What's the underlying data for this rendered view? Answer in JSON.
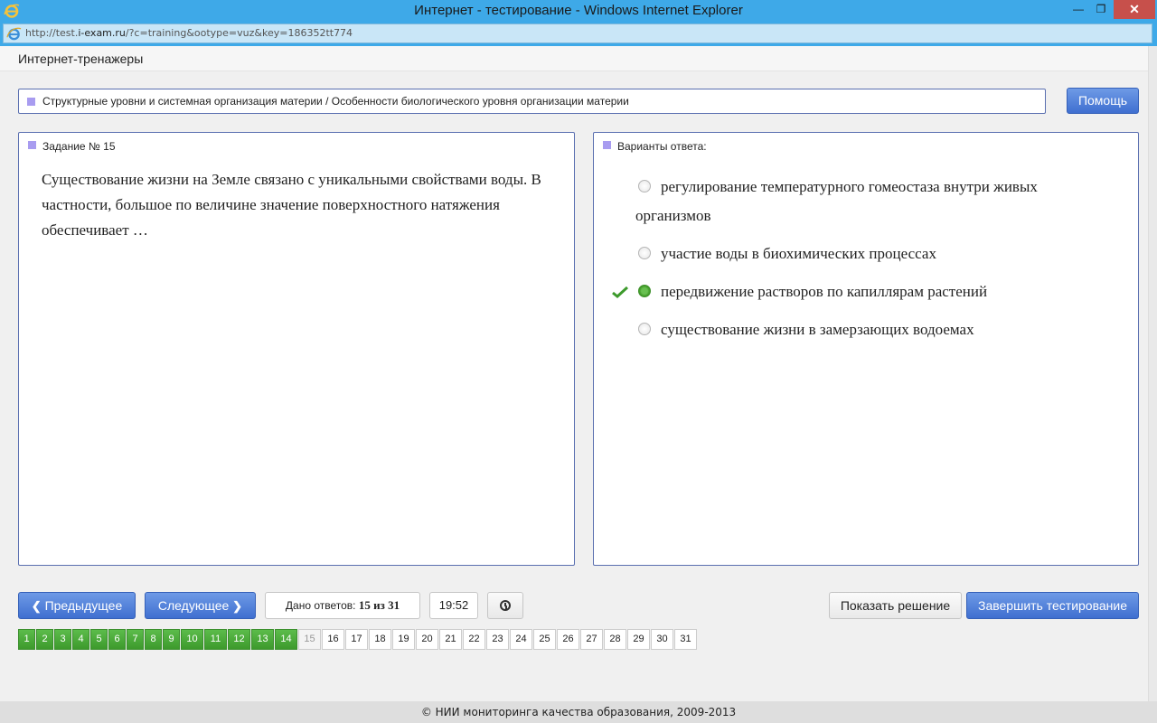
{
  "window": {
    "title": "Интернет - тестирование - Windows Internet Explorer",
    "url_prefix": "http://test.",
    "url_host": "i-exam.ru",
    "url_rest": "/?c=training&ootype=vuz&key=186352tt774",
    "min_glyph": "—",
    "max_glyph": "❐",
    "close_glyph": "✕"
  },
  "header": {
    "brand": "Интернет-тренажеры"
  },
  "breadcrumb": "Структурные уровни и системная организация материи / Особенности биологического уровня организации материи",
  "help_label": "Помощь",
  "question": {
    "heading": "Задание № 15",
    "text": "Существование жизни на Земле связано с уникальными свойствами воды. В частности, большое по величине значение поверхностного натяжения обеспечивает …"
  },
  "answers": {
    "heading": "Варианты ответа:",
    "options": [
      {
        "label": "регулирование температурного гомеостаза внутри живых организмов",
        "selected": false
      },
      {
        "label": "участие воды в биохимических процессах",
        "selected": false
      },
      {
        "label": "передвижение растворов по капиллярам растений",
        "selected": true
      },
      {
        "label": "существование жизни в замерзающих водоемах",
        "selected": false
      }
    ]
  },
  "controls": {
    "prev_label": "Предыдущее",
    "next_label": "Следующее",
    "given_label": "Дано ответов:",
    "given_value": "15 из 31",
    "timer": "19:52",
    "show_solution_label": "Показать решение",
    "finish_label": "Завершить тестирование"
  },
  "pager": {
    "current": 15,
    "pages": [
      "1",
      "2",
      "3",
      "4",
      "5",
      "6",
      "7",
      "8",
      "9",
      "10",
      "11",
      "12",
      "13",
      "14",
      "15",
      "16",
      "17",
      "18",
      "19",
      "20",
      "21",
      "22",
      "23",
      "24",
      "25",
      "26",
      "27",
      "28",
      "29",
      "30",
      "31"
    ],
    "answered_count": 14
  },
  "footer": "© НИИ мониторинга качества образования, 2009-2013",
  "colors": {
    "accent_blue": "#3f6fd0",
    "answered_green": "#3d9a2c",
    "titlebar": "#3ea9e8",
    "close_red": "#c7504b"
  }
}
